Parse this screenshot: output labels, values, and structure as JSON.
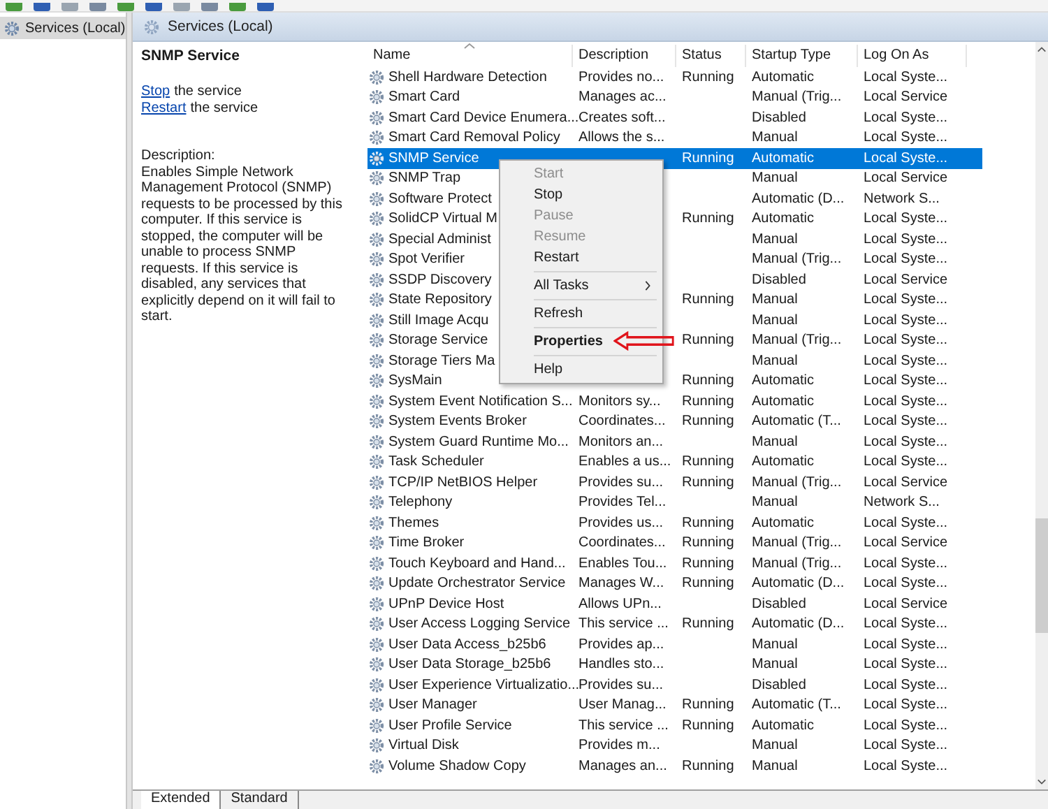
{
  "tree": {
    "items": [
      {
        "label": "Services (Local)",
        "selected": true
      }
    ]
  },
  "pane_header": {
    "title": "Services (Local)"
  },
  "details": {
    "title": "SNMP Service",
    "actions": [
      {
        "link": "Stop",
        "text": "the service"
      },
      {
        "link": "Restart",
        "text": "the service"
      }
    ],
    "description_label": "Description:",
    "description": "Enables Simple Network Management Protocol (SNMP) requests to be processed by this computer. If this service is stopped, the computer will be unable to process SNMP requests. If this service is disabled, any services that explicitly depend on it will fail to start."
  },
  "table": {
    "columns": [
      {
        "label": "Name",
        "sorted": true
      },
      {
        "label": "Description",
        "sorted": false
      },
      {
        "label": "Status",
        "sorted": false
      },
      {
        "label": "Startup Type",
        "sorted": false
      },
      {
        "label": "Log On As",
        "sorted": false
      }
    ],
    "rows": [
      {
        "name": "Shell Hardware Detection",
        "description": "Provides no...",
        "status": "Running",
        "startup_type": "Automatic",
        "log_on_as": "Local Syste...",
        "selected": false
      },
      {
        "name": "Smart Card",
        "description": "Manages ac...",
        "status": "",
        "startup_type": "Manual (Trig...",
        "log_on_as": "Local Service",
        "selected": false
      },
      {
        "name": "Smart Card Device Enumera...",
        "description": "Creates soft...",
        "status": "",
        "startup_type": "Disabled",
        "log_on_as": "Local Syste...",
        "selected": false
      },
      {
        "name": "Smart Card Removal Policy",
        "description": "Allows the s...",
        "status": "",
        "startup_type": "Manual",
        "log_on_as": "Local Syste...",
        "selected": false
      },
      {
        "name": "SNMP Service",
        "description": "",
        "status": "Running",
        "startup_type": "Automatic",
        "log_on_as": "Local Syste...",
        "selected": true
      },
      {
        "name": "SNMP Trap",
        "description": "",
        "status": "",
        "startup_type": "Manual",
        "log_on_as": "Local Service",
        "selected": false
      },
      {
        "name": "Software Protect",
        "description": "",
        "status": "",
        "startup_type": "Automatic (D...",
        "log_on_as": "Network S...",
        "selected": false
      },
      {
        "name": "SolidCP Virtual M",
        "description": "",
        "status": "Running",
        "startup_type": "Automatic",
        "log_on_as": "Local Syste...",
        "selected": false
      },
      {
        "name": "Special Administ",
        "description": "",
        "status": "",
        "startup_type": "Manual",
        "log_on_as": "Local Syste...",
        "selected": false
      },
      {
        "name": "Spot Verifier",
        "description": "",
        "status": "",
        "startup_type": "Manual (Trig...",
        "log_on_as": "Local Syste...",
        "selected": false
      },
      {
        "name": "SSDP Discovery",
        "description": "",
        "status": "",
        "startup_type": "Disabled",
        "log_on_as": "Local Service",
        "selected": false
      },
      {
        "name": "State Repository",
        "description": "",
        "status": "Running",
        "startup_type": "Manual",
        "log_on_as": "Local Syste...",
        "selected": false
      },
      {
        "name": "Still Image Acqu",
        "description": "",
        "status": "",
        "startup_type": "Manual",
        "log_on_as": "Local Syste...",
        "selected": false
      },
      {
        "name": "Storage Service",
        "description": "",
        "status": "Running",
        "startup_type": "Manual (Trig...",
        "log_on_as": "Local Syste...",
        "selected": false
      },
      {
        "name": "Storage Tiers Ma",
        "description": "",
        "status": "",
        "startup_type": "Manual",
        "log_on_as": "Local Syste...",
        "selected": false
      },
      {
        "name": "SysMain",
        "description": "",
        "status": "Running",
        "startup_type": "Automatic",
        "log_on_as": "Local Syste...",
        "selected": false
      },
      {
        "name": "System Event Notification S...",
        "description": "Monitors sy...",
        "status": "Running",
        "startup_type": "Automatic",
        "log_on_as": "Local Syste...",
        "selected": false
      },
      {
        "name": "System Events Broker",
        "description": "Coordinates...",
        "status": "Running",
        "startup_type": "Automatic (T...",
        "log_on_as": "Local Syste...",
        "selected": false
      },
      {
        "name": "System Guard Runtime Mo...",
        "description": "Monitors an...",
        "status": "",
        "startup_type": "Manual",
        "log_on_as": "Local Syste...",
        "selected": false
      },
      {
        "name": "Task Scheduler",
        "description": "Enables a us...",
        "status": "Running",
        "startup_type": "Automatic",
        "log_on_as": "Local Syste...",
        "selected": false
      },
      {
        "name": "TCP/IP NetBIOS Helper",
        "description": "Provides su...",
        "status": "Running",
        "startup_type": "Manual (Trig...",
        "log_on_as": "Local Service",
        "selected": false
      },
      {
        "name": "Telephony",
        "description": "Provides Tel...",
        "status": "",
        "startup_type": "Manual",
        "log_on_as": "Network S...",
        "selected": false
      },
      {
        "name": "Themes",
        "description": "Provides us...",
        "status": "Running",
        "startup_type": "Automatic",
        "log_on_as": "Local Syste...",
        "selected": false
      },
      {
        "name": "Time Broker",
        "description": "Coordinates...",
        "status": "Running",
        "startup_type": "Manual (Trig...",
        "log_on_as": "Local Service",
        "selected": false
      },
      {
        "name": "Touch Keyboard and Hand...",
        "description": "Enables Tou...",
        "status": "Running",
        "startup_type": "Manual (Trig...",
        "log_on_as": "Local Syste...",
        "selected": false
      },
      {
        "name": "Update Orchestrator Service",
        "description": "Manages W...",
        "status": "Running",
        "startup_type": "Automatic (D...",
        "log_on_as": "Local Syste...",
        "selected": false
      },
      {
        "name": "UPnP Device Host",
        "description": "Allows UPn...",
        "status": "",
        "startup_type": "Disabled",
        "log_on_as": "Local Service",
        "selected": false
      },
      {
        "name": "User Access Logging Service",
        "description": "This service ...",
        "status": "Running",
        "startup_type": "Automatic (D...",
        "log_on_as": "Local Syste...",
        "selected": false
      },
      {
        "name": "User Data Access_b25b6",
        "description": "Provides ap...",
        "status": "",
        "startup_type": "Manual",
        "log_on_as": "Local Syste...",
        "selected": false
      },
      {
        "name": "User Data Storage_b25b6",
        "description": "Handles sto...",
        "status": "",
        "startup_type": "Manual",
        "log_on_as": "Local Syste...",
        "selected": false
      },
      {
        "name": "User Experience Virtualizatio...",
        "description": "Provides su...",
        "status": "",
        "startup_type": "Disabled",
        "log_on_as": "Local Syste...",
        "selected": false
      },
      {
        "name": "User Manager",
        "description": "User Manag...",
        "status": "Running",
        "startup_type": "Automatic (T...",
        "log_on_as": "Local Syste...",
        "selected": false
      },
      {
        "name": "User Profile Service",
        "description": "This service ...",
        "status": "Running",
        "startup_type": "Automatic",
        "log_on_as": "Local Syste...",
        "selected": false
      },
      {
        "name": "Virtual Disk",
        "description": "Provides m...",
        "status": "",
        "startup_type": "Manual",
        "log_on_as": "Local Syste...",
        "selected": false
      },
      {
        "name": "Volume Shadow Copy",
        "description": "Manages an...",
        "status": "Running",
        "startup_type": "Manual",
        "log_on_as": "Local Syste...",
        "selected": false
      }
    ]
  },
  "context_menu": {
    "items": [
      {
        "kind": "item",
        "label": "Start",
        "disabled": true
      },
      {
        "kind": "item",
        "label": "Stop",
        "disabled": false
      },
      {
        "kind": "item",
        "label": "Pause",
        "disabled": true
      },
      {
        "kind": "item",
        "label": "Resume",
        "disabled": true
      },
      {
        "kind": "item",
        "label": "Restart",
        "disabled": false
      },
      {
        "kind": "separator"
      },
      {
        "kind": "item",
        "label": "All Tasks",
        "disabled": false,
        "submenu": true
      },
      {
        "kind": "separator"
      },
      {
        "kind": "item",
        "label": "Refresh",
        "disabled": false
      },
      {
        "kind": "separator"
      },
      {
        "kind": "item",
        "label": "Properties",
        "disabled": false,
        "default": true,
        "pointed": true
      },
      {
        "kind": "separator"
      },
      {
        "kind": "item",
        "label": "Help",
        "disabled": false
      }
    ]
  },
  "bottom_tabs": [
    {
      "label": "Extended",
      "selected": true
    },
    {
      "label": "Standard",
      "selected": false
    }
  ]
}
